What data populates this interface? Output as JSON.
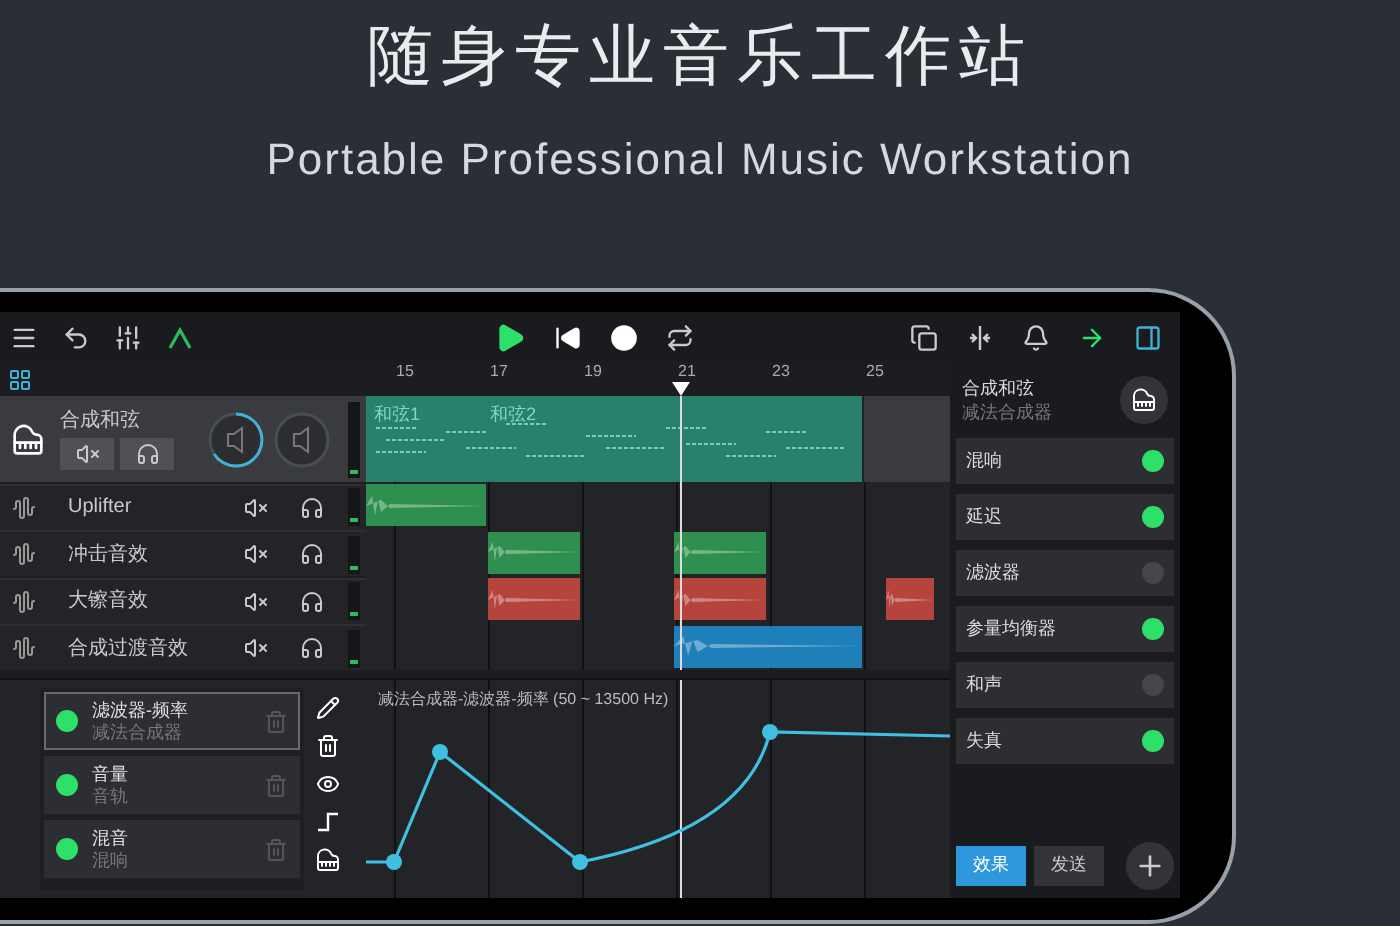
{
  "hero": {
    "title": "随身专业音乐工作站",
    "subtitle": "Portable Professional Music Workstation"
  },
  "ruler": {
    "marks": [
      "15",
      "17",
      "19",
      "21",
      "23",
      "25"
    ]
  },
  "main_track": {
    "name": "合成和弦",
    "color": "#2a8a74",
    "clips": [
      {
        "label": "和弦1"
      },
      {
        "label": "和弦2"
      }
    ]
  },
  "tracks": [
    {
      "name": "Uplifter",
      "color": "#2f8f4e"
    },
    {
      "name": "冲击音效",
      "color": "#2f8f4e"
    },
    {
      "name": "大镲音效",
      "color": "#b5443c"
    },
    {
      "name": "合成过渡音效",
      "color": "#1f7fb8"
    }
  ],
  "automation": [
    {
      "name": "滤波器-频率",
      "source": "减法合成器",
      "selected": true
    },
    {
      "name": "音量",
      "source": "音轨",
      "selected": false
    },
    {
      "name": "混音",
      "source": "混响",
      "selected": false
    }
  ],
  "graph": {
    "title": "减法合成器-滤波器-频率 (50 ~ 13500 Hz)"
  },
  "instrument": {
    "name": "合成和弦",
    "type": "减法合成器"
  },
  "effects": [
    {
      "name": "混响",
      "on": true
    },
    {
      "name": "延迟",
      "on": true
    },
    {
      "name": "滤波器",
      "on": false
    },
    {
      "name": "参量均衡器",
      "on": true
    },
    {
      "name": "和声",
      "on": false
    },
    {
      "name": "失真",
      "on": true
    }
  ],
  "panel_tabs": [
    {
      "label": "效果",
      "selected": true
    },
    {
      "label": "发送",
      "selected": false
    }
  ]
}
